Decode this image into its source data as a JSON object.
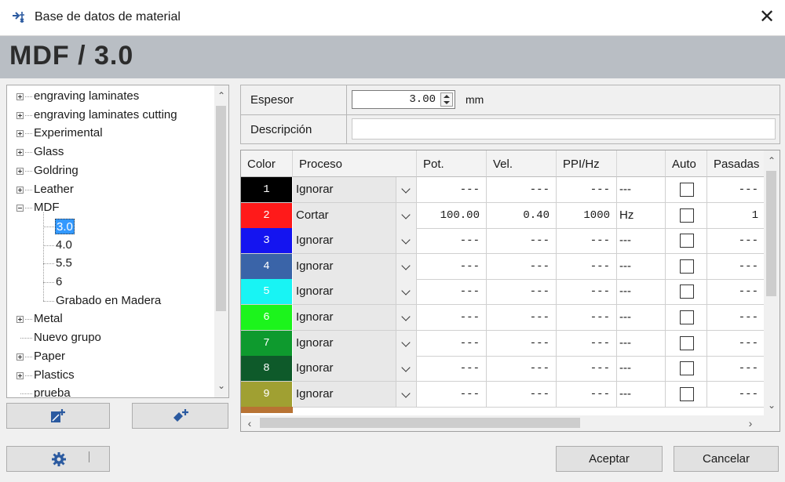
{
  "window": {
    "title": "Base de datos de material",
    "close_symbol": "✕"
  },
  "header": {
    "title": "MDF / 3.0"
  },
  "tree": {
    "items": [
      {
        "label": "engraving laminates",
        "level": 0,
        "expander": "plus"
      },
      {
        "label": "engraving laminates cutting",
        "level": 0,
        "expander": "plus"
      },
      {
        "label": "Experimental",
        "level": 0,
        "expander": "plus"
      },
      {
        "label": "Glass",
        "level": 0,
        "expander": "plus"
      },
      {
        "label": "Goldring",
        "level": 0,
        "expander": "plus"
      },
      {
        "label": "Leather",
        "level": 0,
        "expander": "plus"
      },
      {
        "label": "MDF",
        "level": 0,
        "expander": "minus"
      },
      {
        "label": "3.0",
        "level": 1,
        "selected": true
      },
      {
        "label": "4.0",
        "level": 1
      },
      {
        "label": "5.5",
        "level": 1
      },
      {
        "label": "6",
        "level": 1
      },
      {
        "label": "Grabado en Madera",
        "level": 1
      },
      {
        "label": "Metal",
        "level": 0,
        "expander": "plus"
      },
      {
        "label": "Nuevo grupo",
        "level": 0,
        "expander": "none"
      },
      {
        "label": "Paper",
        "level": 0,
        "expander": "plus"
      },
      {
        "label": "Plastics",
        "level": 0,
        "expander": "plus"
      },
      {
        "label": "prueba",
        "level": 0,
        "expander": "none"
      }
    ]
  },
  "properties": {
    "thickness_label": "Espesor",
    "thickness_value": "3.00",
    "thickness_unit": "mm",
    "description_label": "Descripción",
    "description_value": ""
  },
  "grid": {
    "columns": [
      "Color",
      "Proceso",
      "Pot.",
      "Vel.",
      "PPI/Hz",
      "",
      "Auto",
      "Pasadas"
    ],
    "rows": [
      {
        "color_index": "1",
        "color": "#000000",
        "process": "Ignorar",
        "power": "---",
        "speed": "---",
        "ppi": "---",
        "unit": "---",
        "auto": false,
        "passes": "---"
      },
      {
        "color_index": "2",
        "color": "#ff1a1a",
        "process": "Cortar",
        "power": "100.00",
        "speed": "0.40",
        "ppi": "1000",
        "unit": "Hz",
        "auto": false,
        "passes": "1"
      },
      {
        "color_index": "3",
        "color": "#1414f0",
        "process": "Ignorar",
        "power": "---",
        "speed": "---",
        "ppi": "---",
        "unit": "---",
        "auto": false,
        "passes": "---"
      },
      {
        "color_index": "4",
        "color": "#3a64a8",
        "process": "Ignorar",
        "power": "---",
        "speed": "---",
        "ppi": "---",
        "unit": "---",
        "auto": false,
        "passes": "---"
      },
      {
        "color_index": "5",
        "color": "#18f4f4",
        "process": "Ignorar",
        "power": "---",
        "speed": "---",
        "ppi": "---",
        "unit": "---",
        "auto": false,
        "passes": "---"
      },
      {
        "color_index": "6",
        "color": "#1cf41c",
        "process": "Ignorar",
        "power": "---",
        "speed": "---",
        "ppi": "---",
        "unit": "---",
        "auto": false,
        "passes": "---"
      },
      {
        "color_index": "7",
        "color": "#0e9a2e",
        "process": "Ignorar",
        "power": "---",
        "speed": "---",
        "ppi": "---",
        "unit": "---",
        "auto": false,
        "passes": "---"
      },
      {
        "color_index": "8",
        "color": "#0e5a2a",
        "process": "Ignorar",
        "power": "---",
        "speed": "---",
        "ppi": "---",
        "unit": "---",
        "auto": false,
        "passes": "---"
      },
      {
        "color_index": "9",
        "color": "#a0a032",
        "process": "Ignorar",
        "power": "---",
        "speed": "---",
        "ppi": "---",
        "unit": "---",
        "auto": false,
        "passes": "---"
      }
    ]
  },
  "buttons": {
    "accept": "Aceptar",
    "cancel": "Cancelar"
  },
  "icons": {
    "app": "app-icon",
    "add_material": "add-material-icon",
    "add_group": "add-group-icon",
    "settings": "gear-icon"
  }
}
